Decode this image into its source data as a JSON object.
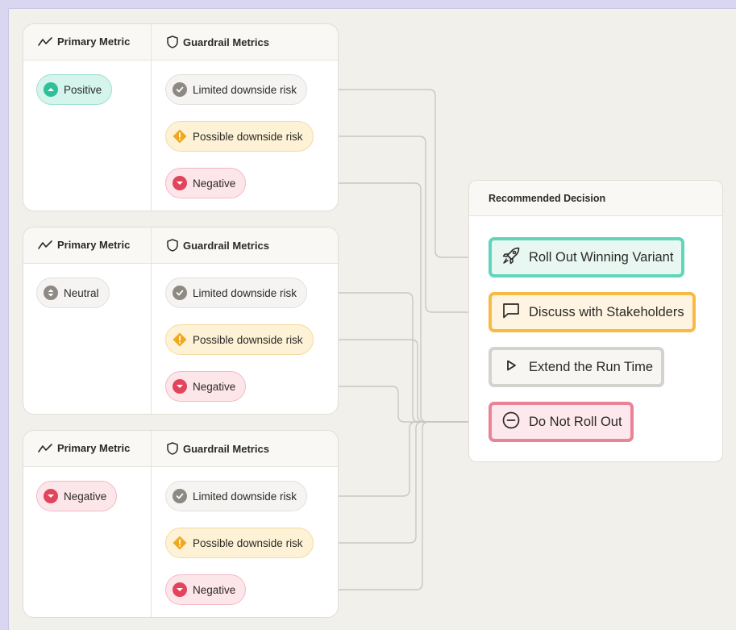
{
  "colors": {
    "line": "#c9c7c2",
    "positive": "#2fbf9b",
    "caution": "#f2a81d",
    "negative": "#e2445c",
    "neutral": "#8d8a84",
    "rollout_border": "#5fd6bb",
    "discuss_border": "#f6bb45",
    "extend_border": "#d4d2cd",
    "donot_border": "#ea8397"
  },
  "panels": [
    {
      "primary_header": "Primary Metric",
      "guardrail_header": "Guardrail Metrics",
      "primary": {
        "label": "Positive",
        "kind": "positive"
      },
      "guardrails": [
        {
          "label": "Limited downside risk",
          "kind": "limited"
        },
        {
          "label": "Possible downside risk",
          "kind": "possible"
        },
        {
          "label": "Negative",
          "kind": "negative"
        }
      ]
    },
    {
      "primary_header": "Primary Metric",
      "guardrail_header": "Guardrail Metrics",
      "primary": {
        "label": "Neutral",
        "kind": "neutral"
      },
      "guardrails": [
        {
          "label": "Limited downside risk",
          "kind": "limited"
        },
        {
          "label": "Possible downside risk",
          "kind": "possible"
        },
        {
          "label": "Negative",
          "kind": "negative"
        }
      ]
    },
    {
      "primary_header": "Primary Metric",
      "guardrail_header": "Guardrail Metrics",
      "primary": {
        "label": "Negative",
        "kind": "negative"
      },
      "guardrails": [
        {
          "label": "Limited downside risk",
          "kind": "limited"
        },
        {
          "label": "Possible downside risk",
          "kind": "possible"
        },
        {
          "label": "Negative",
          "kind": "negative"
        }
      ]
    }
  ],
  "decision": {
    "title": "Recommended Decision",
    "options": [
      {
        "label": "Roll Out Winning Variant",
        "icon": "rocket-icon",
        "fill": "#e8f7f1"
      },
      {
        "label": "Discuss with Stakeholders",
        "icon": "chat-bubble-icon",
        "fill": "#fff4e2"
      },
      {
        "label": "Extend the Run Time",
        "icon": "play-icon",
        "fill": "#f7f6f3"
      },
      {
        "label": "Do Not Roll Out",
        "icon": "minus-circle-icon",
        "fill": "#fde9ed"
      }
    ]
  }
}
